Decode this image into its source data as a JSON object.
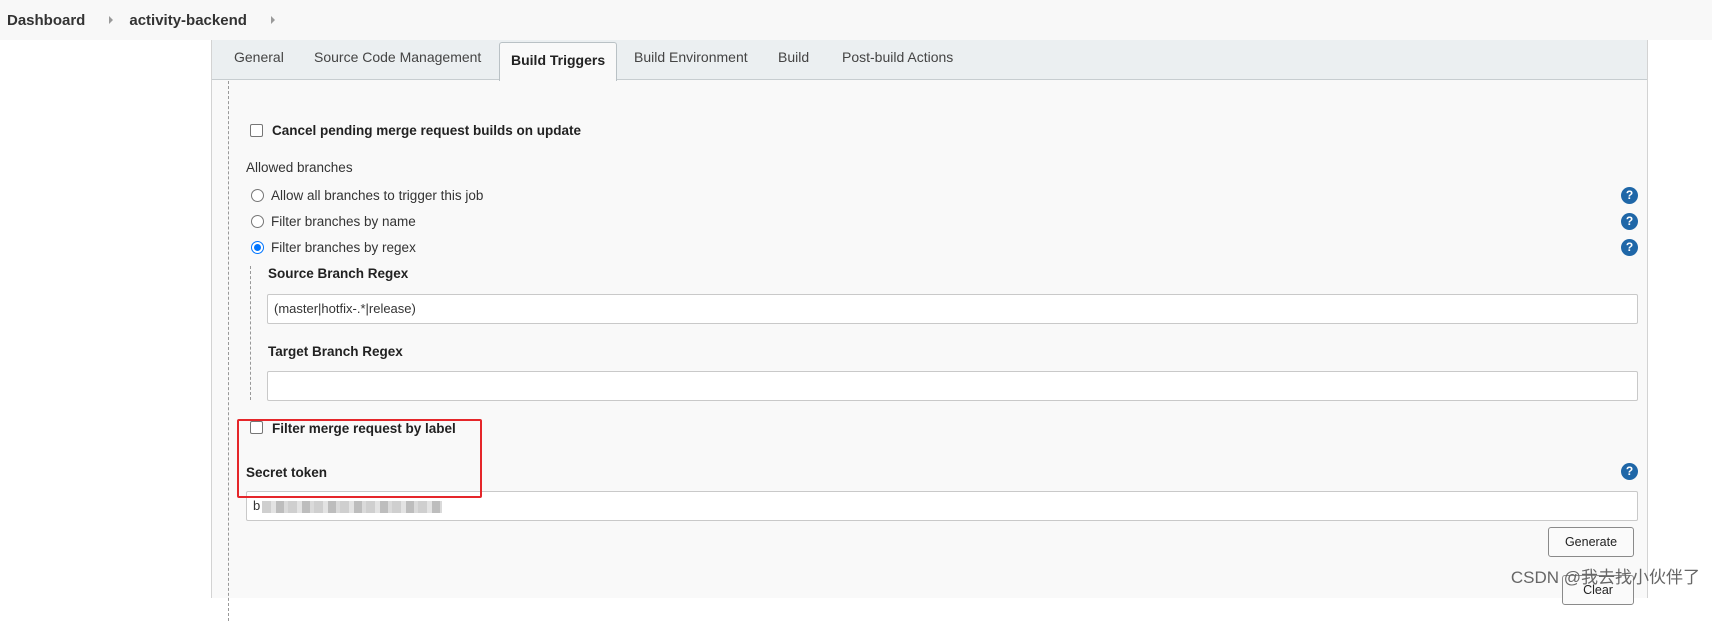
{
  "breadcrumb": {
    "items": [
      "Dashboard",
      "activity-backend"
    ]
  },
  "tabs": [
    {
      "label": "General",
      "active": false
    },
    {
      "label": "Source Code Management",
      "active": false
    },
    {
      "label": "Build Triggers",
      "active": true
    },
    {
      "label": "Build Environment",
      "active": false
    },
    {
      "label": "Build",
      "active": false
    },
    {
      "label": "Post-build Actions",
      "active": false
    }
  ],
  "form": {
    "cancel_pending": {
      "label": "Cancel pending merge request builds on update",
      "checked": false
    },
    "allowed_branches": {
      "heading": "Allowed branches",
      "options": [
        {
          "label": "Allow all branches to trigger this job",
          "selected": false
        },
        {
          "label": "Filter branches by name",
          "selected": false
        },
        {
          "label": "Filter branches by regex",
          "selected": true
        }
      ]
    },
    "source_branch_regex": {
      "label": "Source Branch Regex",
      "value": "(master|hotfix-.*|release)"
    },
    "target_branch_regex": {
      "label": "Target Branch Regex",
      "value": ""
    },
    "filter_by_label": {
      "label": "Filter merge request by label",
      "checked": false
    },
    "secret_token": {
      "label": "Secret token",
      "value_visible_prefix": "b"
    },
    "generate_label": "Generate",
    "clear_label": "Clear"
  },
  "help_icon_glyph": "?",
  "watermark": "CSDN @我去找小伙伴了",
  "colors": {
    "help_icon": "#1f67a8",
    "highlight_box": "#e5262a",
    "radio_selected": "#0075ff"
  }
}
